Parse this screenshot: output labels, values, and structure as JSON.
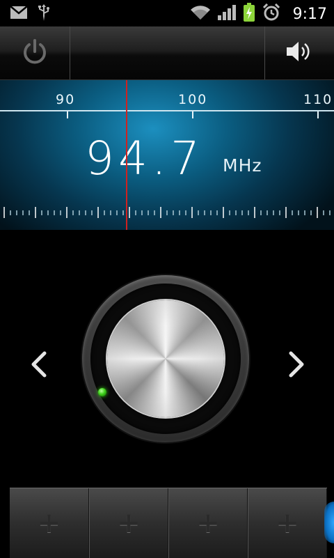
{
  "status_bar": {
    "time": "9:17",
    "icons": [
      "gmail-icon",
      "usb-icon",
      "wifi-icon",
      "signal-icon",
      "battery-charging-icon",
      "alarm-icon"
    ]
  },
  "toolbar": {
    "power_icon": "power-icon",
    "volume_icon": "volume-icon"
  },
  "tuner": {
    "scale_labels": [
      "90",
      "100",
      "110"
    ],
    "frequency": "94.7",
    "unit": "MHz",
    "accent_color": "#1c8fbf",
    "needle_color": "#d0211f"
  },
  "knob": {
    "prev_icon": "chevron-left-icon",
    "next_icon": "chevron-right-icon",
    "led_color": "#3ed11a"
  },
  "presets": [
    {
      "label": "+"
    },
    {
      "label": "+"
    },
    {
      "label": "+"
    },
    {
      "label": "+"
    }
  ]
}
